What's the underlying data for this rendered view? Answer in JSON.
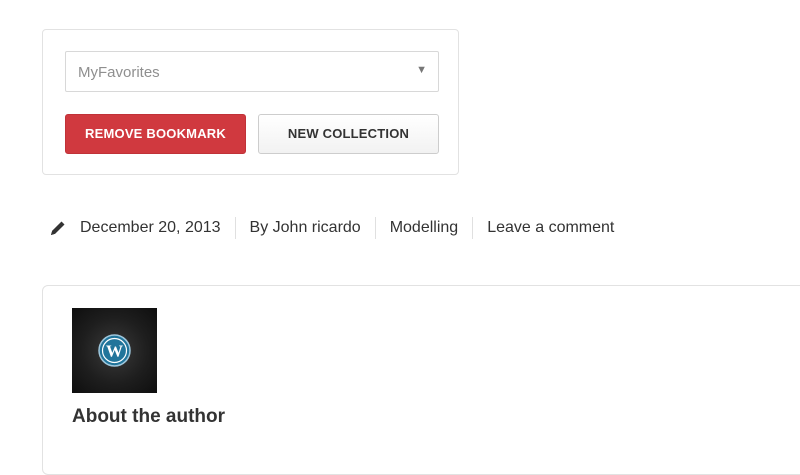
{
  "bookmark": {
    "collection_select": {
      "value": "MyFavorites",
      "arrow_icon": "triangle-down-icon"
    },
    "remove_label": "REMOVE BOOKMARK",
    "new_label": "NEW COLLECTION",
    "colors": {
      "remove_bg": "#d0393f",
      "remove_text": "#ffffff",
      "new_bg": "#f5f5f5",
      "new_text": "#333333"
    }
  },
  "post_meta": {
    "icon": "pencil-icon",
    "date": "December 20, 2013",
    "author": "By John ricardo",
    "category": "Modelling",
    "comment": "Leave a comment"
  },
  "author_box": {
    "avatar_icon": "wordpress-logo-icon",
    "title": "About the author"
  }
}
